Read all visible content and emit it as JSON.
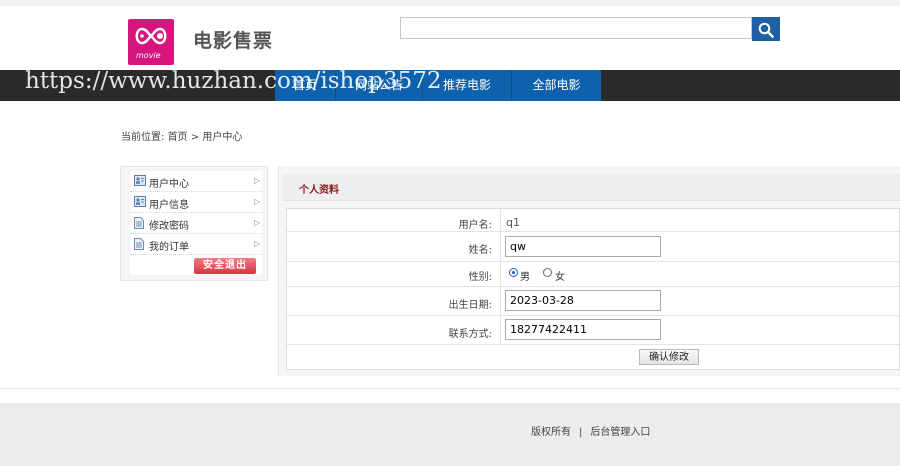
{
  "header": {
    "site_title": "电影售票",
    "logo_text": "movie",
    "search": {
      "value": "",
      "placeholder": ""
    }
  },
  "nav": {
    "items": [
      {
        "label": "首页"
      },
      {
        "label": "网站公告"
      },
      {
        "label": "推荐电影"
      },
      {
        "label": "全部电影"
      }
    ]
  },
  "watermark": "https://www.huzhan.com/ishop3572",
  "breadcrumb": {
    "prefix": "当前位置:",
    "home": "首页",
    "separator": ">",
    "current": "用户中心"
  },
  "sidebar": {
    "items": [
      {
        "label": "用户中心",
        "icon": "user-card-icon"
      },
      {
        "label": "用户信息",
        "icon": "user-card-icon"
      },
      {
        "label": "修改密码",
        "icon": "document-icon"
      },
      {
        "label": "我的订单",
        "icon": "document-icon"
      }
    ],
    "arrow": "▷",
    "logout_label": "安全退出"
  },
  "profile": {
    "title": "个人资料",
    "username_label": "用户名:",
    "username_value": "q1",
    "name_label": "姓名:",
    "name_value": "qw",
    "gender_label": "性别:",
    "gender_male": "男",
    "gender_female": "女",
    "gender_selected": "男",
    "birth_label": "出生日期:",
    "birth_value": "2023-03-28",
    "phone_label": "联系方式:",
    "phone_value": "18277422411",
    "submit_label": "确认修改"
  },
  "footer": {
    "copyright": "版权所有",
    "separator": "|",
    "admin_link": "后台管理入口"
  },
  "colors": {
    "brand_pink": "#d6157f",
    "nav_dark": "#2a2a2a",
    "nav_blue": "#0d61ad",
    "search_btn": "#1e5fa6",
    "logout_red": "#d9363f",
    "panel_title": "#8b1a1a"
  }
}
